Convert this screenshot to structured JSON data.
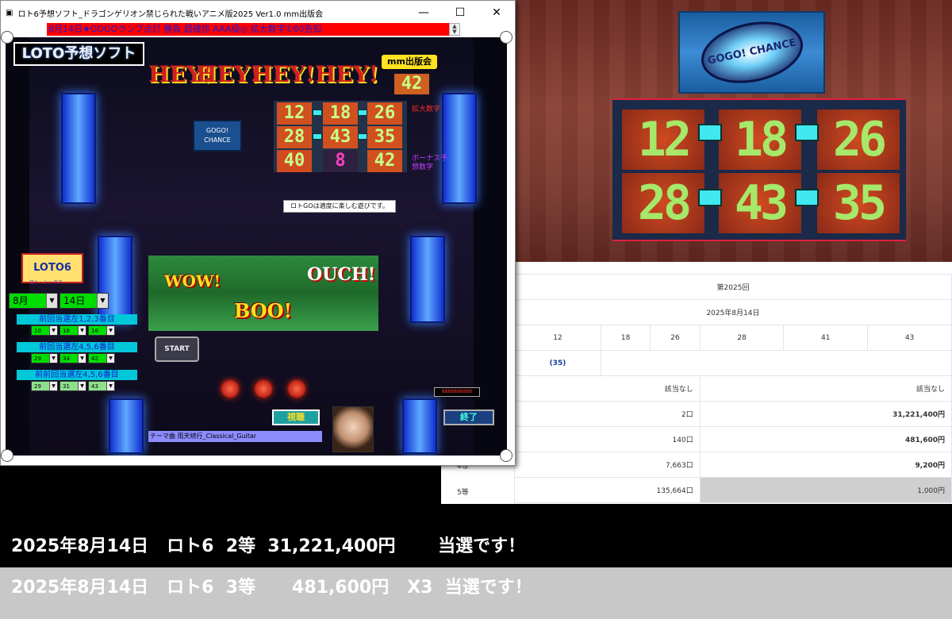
{
  "window": {
    "title": "ロト6予想ソフト_ドラゴンゲリオン禁じられた戦いアニメ版2025  Ver1.0 mm出版会",
    "minimize_icon": "minimize-icon",
    "maximize_icon": "maximize-icon",
    "close_icon": "close-icon"
  },
  "ticker": "8月14日★GOGOランプ点灯 勝負 超確信 AAA級◎ 拡大数字①60告知",
  "app": {
    "logo_label": "LOTO予想ソフト",
    "publisher_badge": "mm出版会",
    "top_number": "42",
    "hey_text": [
      "HEY!",
      "HEY!",
      "HEY!",
      "HEY!"
    ],
    "numbers_row1": [
      "12",
      "18",
      "26"
    ],
    "numbers_row2": [
      "28",
      "43",
      "35"
    ],
    "numbers_row3": [
      "40",
      "8",
      "42"
    ],
    "side_label_top": "拡大数字",
    "side_label_bottom": "ボーナス予想数字",
    "gogo_small": "GOGO! CHANCE",
    "notice": "ロトGOは適度に楽しむ遊びです。",
    "loto6_logo": "LOTO6",
    "loto6_sub": "ロト・シックス",
    "month_select": "8月",
    "day_select": "14日",
    "groups": [
      {
        "label": "前回当選左1,2,3番目",
        "values": [
          "10",
          "18",
          "16"
        ]
      },
      {
        "label": "前回当選左4,5,6番目",
        "values": [
          "29",
          "34",
          "42"
        ]
      },
      {
        "label": "前前回当選左4,5,6番目",
        "values": [
          "29",
          "31",
          "43"
        ]
      }
    ],
    "comic_wow": "WOW!",
    "comic_boo": "BOO!",
    "comic_ouch": "OUCH!",
    "start_label": "START",
    "view_button": "視聴",
    "end_button": "終了",
    "theme_text": "テーマ曲  雨天続行_Classical_Guitar",
    "counter_text": "8888888888"
  },
  "right_panel": {
    "gogo_banner": "GOGO! CHANCE",
    "big_numbers_row1": [
      "12",
      "18",
      "26"
    ],
    "big_numbers_row2": [
      "28",
      "43",
      "35"
    ]
  },
  "results": {
    "col_label": "回別",
    "draw": "第2025回",
    "date": "2025年8月14日",
    "main_numbers": [
      "12",
      "18",
      "26",
      "28",
      "41",
      "43"
    ],
    "bonus": "(35)",
    "rows": [
      {
        "label": "",
        "count": "該当なし",
        "prize": "該当なし",
        "prize_grey": false
      },
      {
        "label": "",
        "count": "2口",
        "prize": "31,221,400円",
        "prize_grey": false
      },
      {
        "label": "",
        "count": "140口",
        "prize": "481,600円",
        "prize_grey": false
      },
      {
        "label": "4等",
        "count": "7,663口",
        "prize": "9,200円",
        "prize_grey": false
      },
      {
        "label": "5等",
        "count": "135,664口",
        "prize": "1,000円",
        "prize_grey": true
      }
    ]
  },
  "banner1": "2025年8月14日   ロト6  2等  31,221,400円       当選です！",
  "banner2": "2025年8月14日   ロト6  3等      481,600円   X3  当選です！"
}
